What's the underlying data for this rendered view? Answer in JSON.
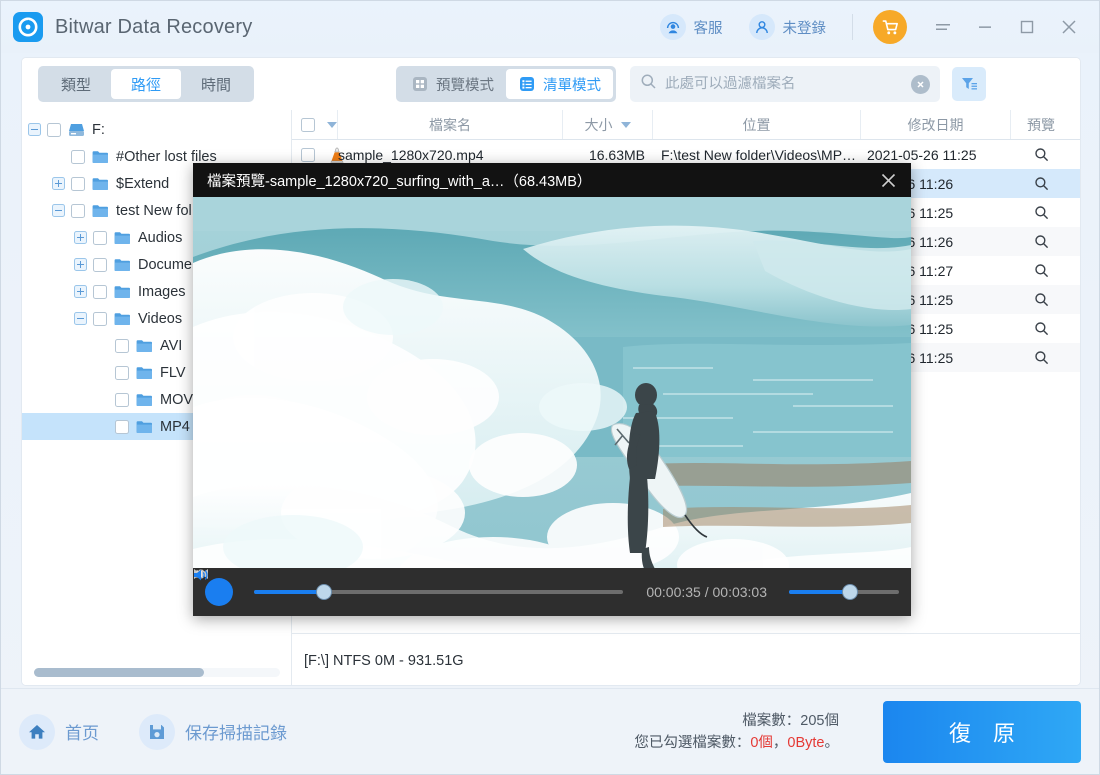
{
  "titlebar": {
    "app_title": "Bitwar Data Recovery",
    "logo_icon": "bitwar-logo-icon",
    "support_label": "客服",
    "support_icon": "headset-user-icon",
    "account_label": "未登錄",
    "account_icon": "user-icon",
    "cart_icon": "shopping-cart-icon",
    "menu_icon": "hamburger-menu-icon",
    "minimize_icon": "minimize-icon",
    "maximize_icon": "maximize-icon",
    "close_icon": "close-icon"
  },
  "toolbar": {
    "segments": [
      {
        "label": "類型",
        "active": false
      },
      {
        "label": "路徑",
        "active": true
      },
      {
        "label": "時間",
        "active": false
      }
    ],
    "modes": [
      {
        "label": "預覽模式",
        "icon": "grid-view-icon",
        "active": false
      },
      {
        "label": "清單模式",
        "icon": "list-view-icon",
        "active": true
      }
    ],
    "search": {
      "placeholder": "此處可以過濾檔案名",
      "value": "",
      "search_icon": "search-icon",
      "clear_icon": "clear-circle-icon"
    },
    "filter_icon": "funnel-filter-icon"
  },
  "tree": {
    "items": [
      {
        "label": "F:",
        "indent": 0,
        "toggle": "minus",
        "icon": "drive-icon",
        "selected": false
      },
      {
        "label": "#Other lost files",
        "indent": 1,
        "toggle": "none",
        "icon": "folder-icon",
        "selected": false
      },
      {
        "label": "$Extend",
        "indent": 1,
        "toggle": "plus",
        "icon": "folder-icon",
        "selected": false
      },
      {
        "label": "test New fol",
        "indent": 1,
        "toggle": "minus",
        "icon": "folder-icon",
        "selected": false
      },
      {
        "label": "Audios",
        "indent": 2,
        "toggle": "plus",
        "icon": "folder-icon",
        "selected": false
      },
      {
        "label": "Documen",
        "indent": 2,
        "toggle": "plus",
        "icon": "folder-icon",
        "selected": false
      },
      {
        "label": "Images",
        "indent": 2,
        "toggle": "plus",
        "icon": "folder-icon",
        "selected": false
      },
      {
        "label": "Videos",
        "indent": 2,
        "toggle": "minus",
        "icon": "folder-icon",
        "selected": false
      },
      {
        "label": "AVI",
        "indent": 3,
        "toggle": "none",
        "icon": "folder-icon",
        "selected": false
      },
      {
        "label": "FLV",
        "indent": 3,
        "toggle": "none",
        "icon": "folder-icon",
        "selected": false
      },
      {
        "label": "MOV",
        "indent": 3,
        "toggle": "none",
        "icon": "folder-icon",
        "selected": false
      },
      {
        "label": "MP4",
        "indent": 3,
        "toggle": "none",
        "icon": "folder-icon",
        "selected": true
      }
    ]
  },
  "table": {
    "headers": {
      "name": "檔案名",
      "size": "大小",
      "location": "位置",
      "date": "修改日期",
      "preview": "預覽"
    },
    "rows": [
      {
        "name": "sample_1280x720.mp4",
        "size": "16.63MB",
        "location": "F:\\test New folder\\Videos\\MP…",
        "date": "2021-05-26  11:25",
        "icon": "vlc-media-file-icon",
        "highlighted": false
      },
      {
        "name": "",
        "size": "",
        "location": "",
        "date": "1-05-26  11:26",
        "icon": "vlc-media-file-icon",
        "highlighted": true
      },
      {
        "name": "",
        "size": "",
        "location": "",
        "date": "1-05-26  11:25",
        "icon": "vlc-media-file-icon",
        "highlighted": false
      },
      {
        "name": "",
        "size": "",
        "location": "",
        "date": "1-05-26  11:26",
        "icon": "vlc-media-file-icon",
        "highlighted": false
      },
      {
        "name": "",
        "size": "",
        "location": "",
        "date": "1-05-26  11:27",
        "icon": "vlc-media-file-icon",
        "highlighted": false
      },
      {
        "name": "",
        "size": "",
        "location": "",
        "date": "1-05-26  11:25",
        "icon": "vlc-media-file-icon",
        "highlighted": false
      },
      {
        "name": "",
        "size": "",
        "location": "",
        "date": "1-05-26  11:25",
        "icon": "vlc-media-file-icon",
        "highlighted": false
      },
      {
        "name": "",
        "size": "",
        "location": "",
        "date": "1-05-26  11:25",
        "icon": "vlc-media-file-icon",
        "highlighted": false
      }
    ],
    "preview_icon": "magnifier-icon",
    "status_line": "[F:\\] NTFS 0M - 931.51G"
  },
  "preview_dialog": {
    "title": "檔案預覽-sample_1280x720_surfing_with_a…（68.43MB）",
    "close_icon": "close-icon",
    "controls": {
      "play_state_icon": "pause-icon",
      "rewind_icon": "rewind-icon",
      "forward_icon": "fast-forward-icon",
      "volume_icon": "volume-icon",
      "time_label": "00:00:35 / 00:03:03",
      "seek_percent": 19,
      "volume_percent": 55
    }
  },
  "footer": {
    "home_label": "首页",
    "home_icon": "home-icon",
    "save_label": "保存掃描記錄",
    "save_icon": "save-disk-icon",
    "file_count_label": "檔案數：205個",
    "selected_prefix": "您已勾選檔案數：",
    "selected_count": "0個",
    "selected_sep": "，",
    "selected_size": "0Byte",
    "selected_suffix": "。",
    "recover_label": "復 原"
  },
  "colors": {
    "accent": "#2f9bf5",
    "accent_dark": "#1b86ef",
    "cart": "#f7a928",
    "selection": "#c5e3fb",
    "danger": "#e53935"
  }
}
